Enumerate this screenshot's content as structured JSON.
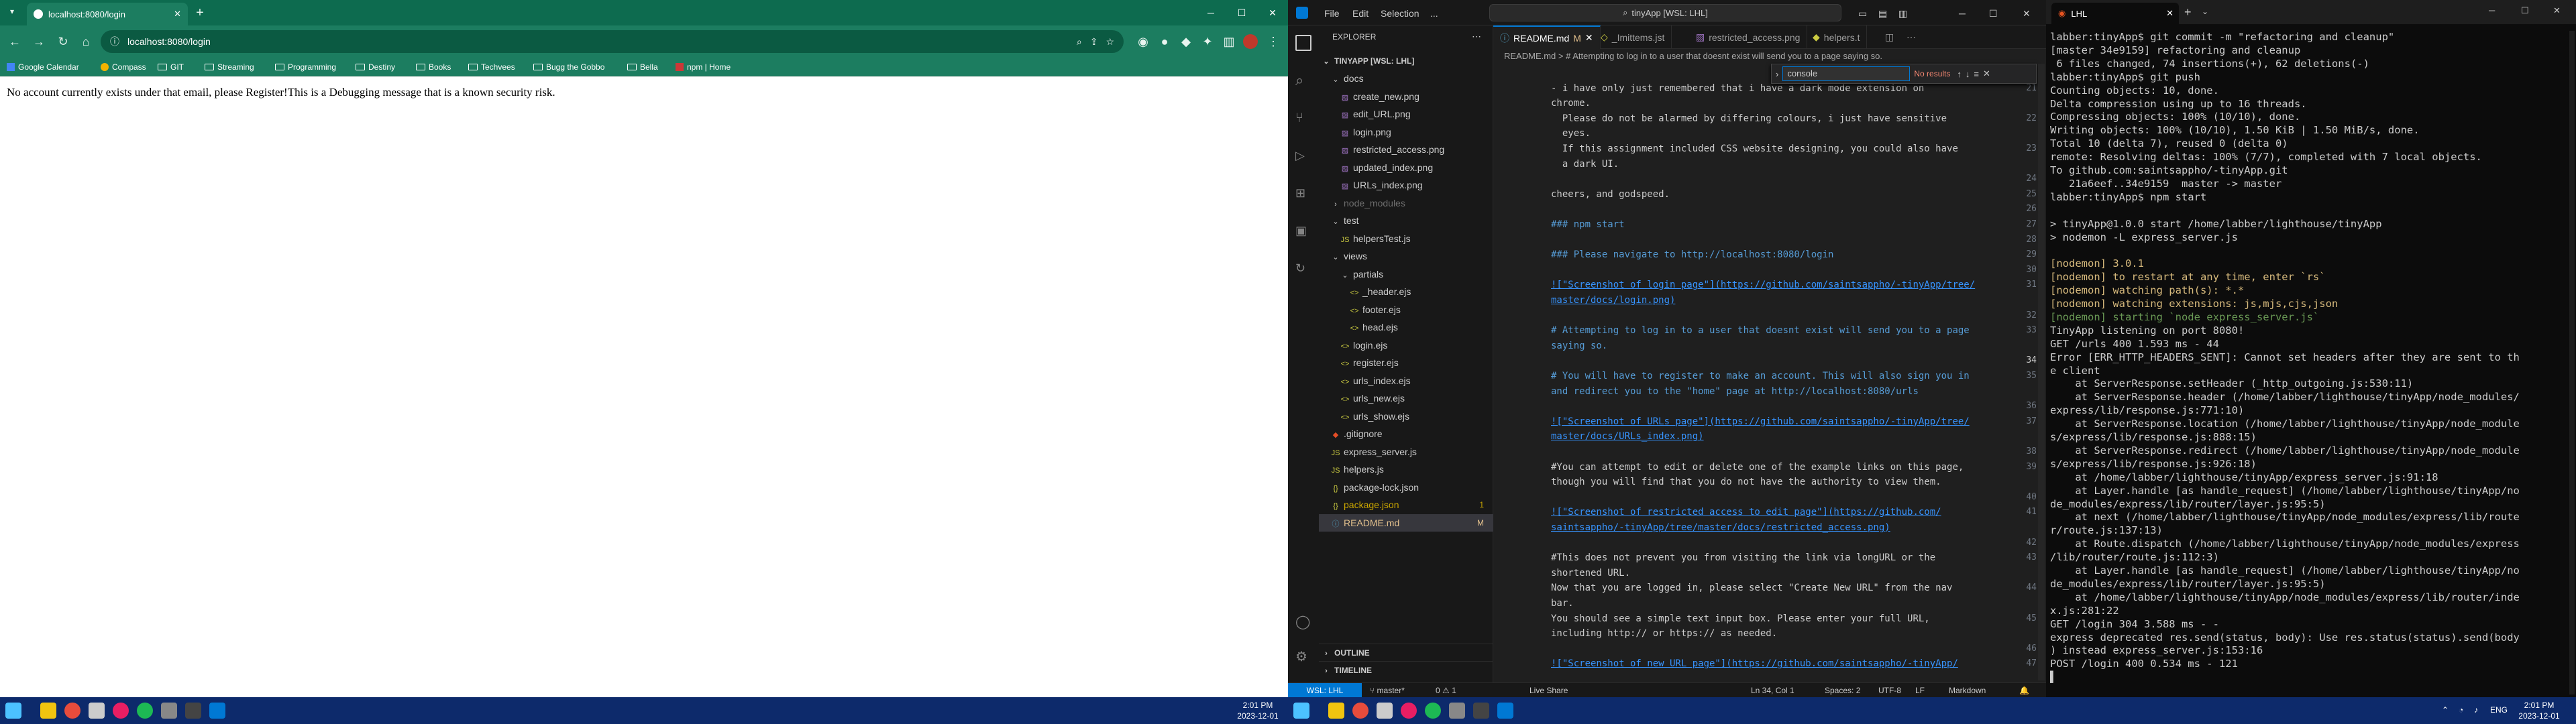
{
  "chrome": {
    "tab_title": "localhost:8080/login",
    "url": "localhost:8080/login",
    "bookmarks": [
      "Google Calendar",
      "Compass",
      "GIT",
      "Streaming",
      "Programming",
      "Destiny",
      "Books",
      "Techvees",
      "Bugg the Gobbo",
      "Bella",
      "npm | Home"
    ],
    "page_text": "No account currently exists under that email, please Register!This is a Debugging message that is a known security risk."
  },
  "taskbar_left": {
    "time": "2:01 PM",
    "date": "2023-12-01"
  },
  "taskbar_right": {
    "time": "2:01 PM",
    "date": "2023-12-01",
    "lang": "ENG"
  },
  "vscode": {
    "menu": [
      "File",
      "Edit",
      "Selection",
      "..."
    ],
    "command_center": "tinyApp [WSL: LHL]",
    "sidebar_title": "EXPLORER",
    "project": "TINYAPP [WSL: LHL]",
    "tree": [
      {
        "label": "docs",
        "type": "folder-open",
        "indent": 1
      },
      {
        "label": "create_new.png",
        "type": "img",
        "indent": 2
      },
      {
        "label": "edit_URL.png",
        "type": "img",
        "indent": 2
      },
      {
        "label": "login.png",
        "type": "img",
        "indent": 2
      },
      {
        "label": "restricted_access.png",
        "type": "img",
        "indent": 2
      },
      {
        "label": "updated_index.png",
        "type": "img",
        "indent": 2
      },
      {
        "label": "URLs_index.png",
        "type": "img",
        "indent": 2
      },
      {
        "label": "node_modules",
        "type": "folder",
        "indent": 1,
        "dim": true
      },
      {
        "label": "test",
        "type": "folder-open",
        "indent": 1
      },
      {
        "label": "helpersTest.js",
        "type": "js",
        "indent": 2
      },
      {
        "label": "views",
        "type": "folder-open",
        "indent": 1
      },
      {
        "label": "partials",
        "type": "folder-open",
        "indent": 2
      },
      {
        "label": "_header.ejs",
        "type": "ejs",
        "indent": 3
      },
      {
        "label": "footer.ejs",
        "type": "ejs",
        "indent": 3
      },
      {
        "label": "head.ejs",
        "type": "ejs",
        "indent": 3
      },
      {
        "label": "login.ejs",
        "type": "ejs",
        "indent": 2
      },
      {
        "label": "register.ejs",
        "type": "ejs",
        "indent": 2
      },
      {
        "label": "urls_index.ejs",
        "type": "ejs",
        "indent": 2
      },
      {
        "label": "urls_new.ejs",
        "type": "ejs",
        "indent": 2
      },
      {
        "label": "urls_show.ejs",
        "type": "ejs",
        "indent": 2
      },
      {
        "label": ".gitignore",
        "type": "git",
        "indent": 1
      },
      {
        "label": "express_server.js",
        "type": "js",
        "indent": 1
      },
      {
        "label": "helpers.js",
        "type": "js",
        "indent": 1
      },
      {
        "label": "package-lock.json",
        "type": "json",
        "indent": 1
      },
      {
        "label": "package.json",
        "type": "json",
        "indent": 1,
        "badge": "1"
      },
      {
        "label": "README.md",
        "type": "md",
        "indent": 1,
        "badge": "M",
        "selected": true
      }
    ],
    "outline": "OUTLINE",
    "timeline": "TIMELINE",
    "tabs": [
      {
        "label": "README.md",
        "flag": "M",
        "active": true
      },
      {
        "label": "_Imittems.jst",
        "active": false
      },
      {
        "label": "restricted_access.png",
        "active": false
      },
      {
        "label": "helpers.t",
        "active": false
      }
    ],
    "breadcrumb": "README.md > # Attempting to log in to a user that doesnt exist will send you to a page saying so.",
    "find": {
      "label": "console",
      "result": "No results"
    },
    "lines": [
      {
        "n": "20",
        "t": "",
        "k": "text"
      },
      {
        "n": "21",
        "t": "- i have only just remembered that i have a dark mode extension on",
        "k": "text"
      },
      {
        "n": "",
        "t": "chrome.",
        "k": "text"
      },
      {
        "n": "22",
        "t": "  Please do not be alarmed by differing colours, i just have sensitive",
        "k": "text"
      },
      {
        "n": "",
        "t": "  eyes.",
        "k": "text"
      },
      {
        "n": "23",
        "t": "  If this assignment included CSS website designing, you could also have",
        "k": "text"
      },
      {
        "n": "",
        "t": "  a dark UI.",
        "k": "text"
      },
      {
        "n": "24",
        "t": "",
        "k": "text"
      },
      {
        "n": "25",
        "t": "cheers, and godspeed.",
        "k": "text"
      },
      {
        "n": "26",
        "t": "",
        "k": "text"
      },
      {
        "n": "27",
        "t": "### npm start",
        "k": "head"
      },
      {
        "n": "28",
        "t": "",
        "k": "text"
      },
      {
        "n": "29",
        "t": "### Please navigate to http://localhost:8080/login",
        "k": "head"
      },
      {
        "n": "30",
        "t": "",
        "k": "text"
      },
      {
        "n": "31",
        "t": "![\"Screenshot of login page\"](https://github.com/saintsappho/-tinyApp/tree/",
        "k": "link"
      },
      {
        "n": "",
        "t": "master/docs/login.png)",
        "k": "link"
      },
      {
        "n": "32",
        "t": "",
        "k": "text"
      },
      {
        "n": "33",
        "t": "# Attempting to log in to a user that doesnt exist will send you to a page",
        "k": "head"
      },
      {
        "n": "",
        "t": "saying so.",
        "k": "head"
      },
      {
        "n": "34",
        "t": "",
        "k": "text"
      },
      {
        "n": "35",
        "t": "# You will have to register to make an account. This will also sign you in",
        "k": "head"
      },
      {
        "n": "",
        "t": "and redirect you to the \"home\" page at http://localhost:8080/urls",
        "k": "head"
      },
      {
        "n": "36",
        "t": "",
        "k": "text"
      },
      {
        "n": "37",
        "t": "![\"Screenshot of URLs page\"](https://github.com/saintsappho/-tinyApp/tree/",
        "k": "link"
      },
      {
        "n": "",
        "t": "master/docs/URLs_index.png)",
        "k": "link"
      },
      {
        "n": "38",
        "t": "",
        "k": "text"
      },
      {
        "n": "39",
        "t": "#You can attempt to edit or delete one of the example links on this page,",
        "k": "text"
      },
      {
        "n": "",
        "t": "though you will find that you do not have the authority to view them.",
        "k": "text"
      },
      {
        "n": "40",
        "t": "",
        "k": "text"
      },
      {
        "n": "41",
        "t": "![\"Screenshot of restricted access to edit page\"](https://github.com/",
        "k": "link"
      },
      {
        "n": "",
        "t": "saintsappho/-tinyApp/tree/master/docs/restricted_access.png)",
        "k": "link"
      },
      {
        "n": "42",
        "t": "",
        "k": "text"
      },
      {
        "n": "43",
        "t": "#This does not prevent you from visiting the link via longURL or the",
        "k": "text"
      },
      {
        "n": "",
        "t": "shortened URL.",
        "k": "text"
      },
      {
        "n": "44",
        "t": "Now that you are logged in, please select \"Create New URL\" from the nav",
        "k": "text"
      },
      {
        "n": "",
        "t": "bar.",
        "k": "text"
      },
      {
        "n": "45",
        "t": "You should see a simple text input box. Please enter your full URL,",
        "k": "text"
      },
      {
        "n": "",
        "t": "including http:// or https:// as needed.",
        "k": "text"
      },
      {
        "n": "46",
        "t": "",
        "k": "text"
      },
      {
        "n": "47",
        "t": "![\"Screenshot of new URL page\"](https://github.com/saintsappho/-tinyApp/",
        "k": "link"
      }
    ],
    "status": {
      "remote": "WSL: LHL",
      "branch": "master*",
      "problems": "0 ⚠ 1",
      "live": "Live Share",
      "position": "Ln 34, Col 1",
      "spaces": "Spaces: 2",
      "encoding": "UTF-8",
      "eol": "LF",
      "lang": "Markdown"
    }
  },
  "terminal": {
    "title": "LHL",
    "lines": [
      {
        "t": "labber:tinyApp$ git commit -m \"refactoring and cleanup\"",
        "c": "#cccccc"
      },
      {
        "t": "[master 34e9159] refactoring and cleanup",
        "c": "#cccccc"
      },
      {
        "t": " 6 files changed, 74 insertions(+), 62 deletions(-)",
        "c": "#cccccc"
      },
      {
        "t": "labber:tinyApp$ git push",
        "c": "#cccccc"
      },
      {
        "t": "Counting objects: 10, done.",
        "c": "#cccccc"
      },
      {
        "t": "Delta compression using up to 16 threads.",
        "c": "#cccccc"
      },
      {
        "t": "Compressing objects: 100% (10/10), done.",
        "c": "#cccccc"
      },
      {
        "t": "Writing objects: 100% (10/10), 1.50 KiB | 1.50 MiB/s, done.",
        "c": "#cccccc"
      },
      {
        "t": "Total 10 (delta 7), reused 0 (delta 0)",
        "c": "#cccccc"
      },
      {
        "t": "remote: Resolving deltas: 100% (7/7), completed with 7 local objects.",
        "c": "#cccccc"
      },
      {
        "t": "To github.com:saintsappho/-tinyApp.git",
        "c": "#cccccc"
      },
      {
        "t": "   21a6eef..34e9159  master -> master",
        "c": "#cccccc"
      },
      {
        "t": "labber:tinyApp$ npm start",
        "c": "#cccccc"
      },
      {
        "t": "",
        "c": "#cccccc"
      },
      {
        "t": "> tinyApp@1.0.0 start /home/labber/lighthouse/tinyApp",
        "c": "#cccccc"
      },
      {
        "t": "> nodemon -L express_server.js",
        "c": "#cccccc"
      },
      {
        "t": "",
        "c": "#cccccc"
      },
      {
        "t": "[nodemon] 3.0.1",
        "c": "#d7ba7d"
      },
      {
        "t": "[nodemon] to restart at any time, enter `rs`",
        "c": "#d7ba7d"
      },
      {
        "t": "[nodemon] watching path(s): *.*",
        "c": "#d7ba7d"
      },
      {
        "t": "[nodemon] watching extensions: js,mjs,cjs,json",
        "c": "#d7ba7d"
      },
      {
        "t": "[nodemon] starting `node express_server.js`",
        "c": "#6a9955"
      },
      {
        "t": "TinyApp listening on port 8080!",
        "c": "#cccccc"
      },
      {
        "t": "GET /urls 400 1.593 ms - 44",
        "c": "#cccccc"
      },
      {
        "t": "Error [ERR_HTTP_HEADERS_SENT]: Cannot set headers after they are sent to th",
        "c": "#cccccc"
      },
      {
        "t": "e client",
        "c": "#cccccc"
      },
      {
        "t": "    at ServerResponse.setHeader (_http_outgoing.js:530:11)",
        "c": "#cccccc"
      },
      {
        "t": "    at ServerResponse.header (/home/labber/lighthouse/tinyApp/node_modules/",
        "c": "#cccccc"
      },
      {
        "t": "express/lib/response.js:771:10)",
        "c": "#cccccc"
      },
      {
        "t": "    at ServerResponse.location (/home/labber/lighthouse/tinyApp/node_module",
        "c": "#cccccc"
      },
      {
        "t": "s/express/lib/response.js:888:15)",
        "c": "#cccccc"
      },
      {
        "t": "    at ServerResponse.redirect (/home/labber/lighthouse/tinyApp/node_module",
        "c": "#cccccc"
      },
      {
        "t": "s/express/lib/response.js:926:18)",
        "c": "#cccccc"
      },
      {
        "t": "    at /home/labber/lighthouse/tinyApp/express_server.js:91:18",
        "c": "#cccccc"
      },
      {
        "t": "    at Layer.handle [as handle_request] (/home/labber/lighthouse/tinyApp/no",
        "c": "#cccccc"
      },
      {
        "t": "de_modules/express/lib/router/layer.js:95:5)",
        "c": "#cccccc"
      },
      {
        "t": "    at next (/home/labber/lighthouse/tinyApp/node_modules/express/lib/route",
        "c": "#cccccc"
      },
      {
        "t": "r/route.js:137:13)",
        "c": "#cccccc"
      },
      {
        "t": "    at Route.dispatch (/home/labber/lighthouse/tinyApp/node_modules/express",
        "c": "#cccccc"
      },
      {
        "t": "/lib/router/route.js:112:3)",
        "c": "#cccccc"
      },
      {
        "t": "    at Layer.handle [as handle_request] (/home/labber/lighthouse/tinyApp/no",
        "c": "#cccccc"
      },
      {
        "t": "de_modules/express/lib/router/layer.js:95:5)",
        "c": "#cccccc"
      },
      {
        "t": "    at /home/labber/lighthouse/tinyApp/node_modules/express/lib/router/inde",
        "c": "#cccccc"
      },
      {
        "t": "x.js:281:22",
        "c": "#cccccc"
      },
      {
        "t": "GET /login 304 3.588 ms - -",
        "c": "#cccccc"
      },
      {
        "t": "express deprecated res.send(status, body): Use res.status(status).send(body",
        "c": "#cccccc"
      },
      {
        "t": ") instead express_server.js:153:16",
        "c": "#cccccc"
      },
      {
        "t": "POST /login 400 0.534 ms - 121",
        "c": "#cccccc"
      },
      {
        "t": "▌",
        "c": "#cccccc"
      }
    ]
  },
  "colors": {
    "chrome_accent": "#1c7d60",
    "vscode_accent": "#0078d4",
    "taskbar": "#0d2a6b"
  }
}
